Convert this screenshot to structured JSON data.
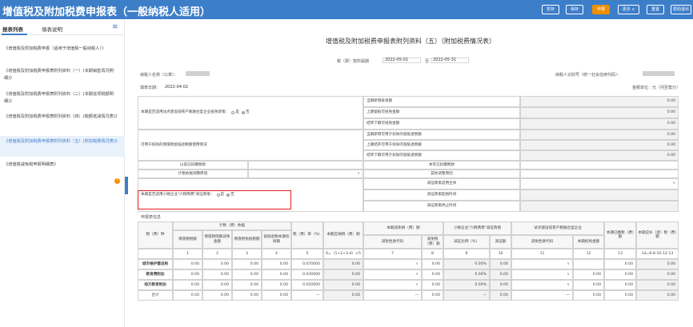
{
  "header": {
    "title": "增值税及附加税费申报表（一般纳税人适用）",
    "buttons": [
      {
        "label": "暂存",
        "style": "normal"
      },
      {
        "label": "保存",
        "style": "normal"
      },
      {
        "label": "申报",
        "style": "orange"
      },
      {
        "label": "更多",
        "style": "normal",
        "icon": "chevron-down-icon"
      },
      {
        "label": "重置",
        "style": "normal"
      },
      {
        "label": "帮助退出",
        "style": "normal"
      }
    ]
  },
  "sidebar": {
    "tabs": [
      "报表列表",
      "填表说明"
    ],
    "items": [
      "《增值税及附加税费申报（适用于增值税一般纳税人）》",
      "《增值税及附加税费申报表附列资料（一）(本期销售情况明细)》",
      "《增值税及附加税费申报表附列资料（二）(本期进项税额明细)》",
      "《增值税及附加税费申报表附列资料（四）(税额抵减情况表)》",
      "《增值税及附加税费申报表附列资料（五）(附加税费情况表)》",
      "《增值税减免税申报明细表》"
    ],
    "badge": "!"
  },
  "form": {
    "title": "增值税及附加税费申报表附列资料（五）（附加税费情况表）",
    "period_label": "税（费）款所属期",
    "period_start": "2022-05-01",
    "period_to": "至",
    "period_end": "2022-05-31",
    "taxpayer_name_label": "纳税人名称（公章）：",
    "taxpayer_id_label": "纳税人识别号（统一社会信用代码）：",
    "fill_date_label": "填表日期：",
    "fill_date": "2022-04-02",
    "unit_label": "金额单位：元（列至角分）"
  },
  "upper_table": {
    "pilot_question": "本期是否适用试点建设培育产教融合型企业抵免政策：",
    "pilot_yes": "是",
    "pilot_no": "否",
    "pilot_rows": [
      {
        "label": "当期新增投资额",
        "value": "0.00"
      },
      {
        "label": "上期留抵可抵免金额",
        "value": "0.00"
      },
      {
        "label": "结转下期可抵免金额",
        "value": "0.00"
      }
    ],
    "refund_label": "可用于扣除的增值税留抵退税额使用情况",
    "refund_rows": [
      {
        "label": "当期新增可用于扣除的留抵退税额",
        "value": "0.00"
      },
      {
        "label": "上期结存可用于扣除的留抵退税额",
        "value": "0.00"
      },
      {
        "label": "结转下期可用于扣除的留抵退税额",
        "value": "0.00"
      }
    ],
    "prev_tax_label": "以前已扣缴税款",
    "current_tax_label": "本年已扣缴税款",
    "calc_change_label": "计税依据调整原因",
    "other_change_label": "其他调整原因",
    "reduction_subject_label": "减征政策适用主体",
    "small_question": "本期是否适用小微企业\"六税两费\"减征政策：",
    "small_yes": "是",
    "small_no": "否",
    "reduction_start_label": "减征政策起始时间",
    "reduction_end_label": "减征政策终止时间"
  },
  "lower_table": {
    "section_label": "申报表信息",
    "header_tax_item": "税（费）种",
    "header_basis_group": "计税（费）依据",
    "header_basis_cols": [
      "增值税税额",
      "增值税限额减免金额",
      "增值税免抵税额",
      "留抵退税本期扣除额"
    ],
    "header_rate": "税（费）率（%）",
    "header_current_amount": "本期应纳税（费）额",
    "header_reduction_group": "本期减免税（费）额",
    "header_reduction_cols": [
      "减免性质代码",
      "减免税（费）额"
    ],
    "header_small_group": "小微企业\"六税两费\"减征政策",
    "header_small_cols": [
      "减征比例（%）",
      "减征额"
    ],
    "header_pilot_group": "试点建设培育产教融合型企业",
    "header_pilot_cols": [
      "减免性质代码",
      "本期抵免金额"
    ],
    "header_paid": "本期已缴税（费）额",
    "header_payable": "本期应补（退）税（费）额",
    "col_numbers": [
      "1",
      "2",
      "3",
      "4",
      "5",
      "6=（1+2+3-4）×5",
      "7",
      "8",
      "9",
      "10",
      "11",
      "12",
      "13",
      "14=6-8-10-12-13"
    ],
    "rows": [
      {
        "name": "城市维护建设税",
        "v1": "0.00",
        "v2": "0.00",
        "v3": "0.00",
        "v4": "0.00",
        "rate": "0.070000",
        "amount": "0.00",
        "code": "",
        "red": "0.00",
        "ratio": "0.00%",
        "small": "0.00",
        "pcode": "",
        "credit": "",
        "paid": "0.00",
        "payable": "0.00"
      },
      {
        "name": "教育费附加",
        "v1": "0.00",
        "v2": "0.00",
        "v3": "0.00",
        "v4": "0.00",
        "rate": "0.030000",
        "amount": "0.00",
        "code": "",
        "red": "0.00",
        "ratio": "0.00%",
        "small": "0.00",
        "pcode": "",
        "credit": "0.00",
        "paid": "0.00",
        "payable": "0.00"
      },
      {
        "name": "地方教育附加",
        "v1": "0.00",
        "v2": "0.00",
        "v3": "0.00",
        "v4": "0.00",
        "rate": "0.020000",
        "amount": "0.00",
        "code": "",
        "red": "0.00",
        "ratio": "0.00%",
        "small": "0.00",
        "pcode": "",
        "credit": "0.00",
        "paid": "0.00",
        "payable": "0.00"
      }
    ],
    "total": {
      "name": "合计",
      "v1": "0.00",
      "v2": "0.00",
      "v3": "0.00",
      "v4": "0.00",
      "rate": "—",
      "amount": "0.00",
      "code": "—",
      "red": "0.00",
      "ratio": "—",
      "small": "0.00",
      "pcode": "—",
      "credit": "0.00",
      "paid": "0.00",
      "payable": "0.00"
    }
  }
}
